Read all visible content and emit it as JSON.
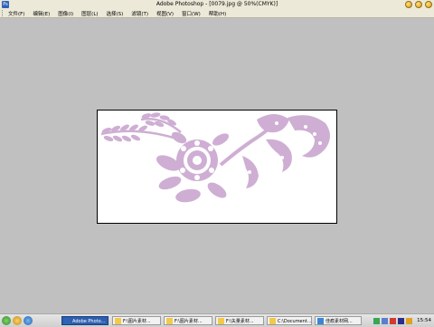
{
  "window": {
    "title": "Adobe Photoshop - [0079.jpg @ 50%(CMYK)]",
    "app_icon": "Ps"
  },
  "menu": {
    "items": [
      "文件(F)",
      "编辑(E)",
      "图像(I)",
      "图层(L)",
      "选择(S)",
      "滤镜(T)",
      "视图(V)",
      "窗口(W)",
      "帮助(H)"
    ]
  },
  "document": {
    "ornament_color": "#cfaed4",
    "background": "#ffffff"
  },
  "taskbar": {
    "tasks": [
      {
        "label": "Adobe Photo...",
        "active": true,
        "icon": "photoshop-icon"
      },
      {
        "label": "F:\\图片素材...",
        "active": false,
        "icon": "folder-icon"
      },
      {
        "label": "F:\\图片素材...",
        "active": false,
        "icon": "folder-icon"
      },
      {
        "label": "F:\\矢量素材...",
        "active": false,
        "icon": "folder-icon"
      },
      {
        "label": "C:\\Document...",
        "active": false,
        "icon": "folder-icon"
      },
      {
        "label": "佳痕素材网...",
        "active": false,
        "icon": "browser-icon"
      }
    ],
    "clock": "15:54"
  }
}
